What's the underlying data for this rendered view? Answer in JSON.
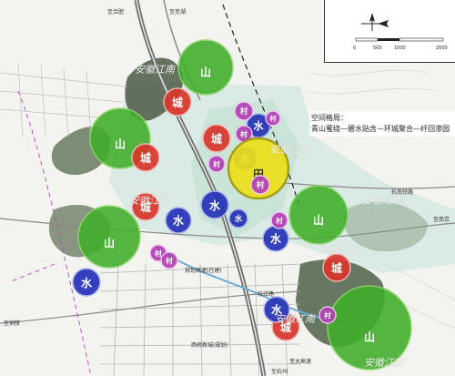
{
  "title": "空间格局：",
  "subtitle": "青山蜜绕—碧水贴含—环城聚合—纤回渗园",
  "road_labels": {
    "top_left": "至合肥",
    "top_mid": "至芜湖",
    "highway_right": "杭南铁路",
    "right_sub": "至南京",
    "mid": "杭江路",
    "left_plan": "规划高速(在建)",
    "bottom_left": "至铜陵",
    "bottom_road": "西桥新城(规划)",
    "bottom_mid": "至杭州",
    "bottom_end": "芜太高速"
  },
  "scale": {
    "ticks": [
      "0",
      "500",
      "1000",
      "2000"
    ]
  },
  "watermark": "安徽江南",
  "markers": [
    {
      "type": "mountain",
      "label": "山"
    },
    {
      "type": "mountain",
      "label": "山"
    },
    {
      "type": "mountain",
      "label": "山"
    },
    {
      "type": "mountain",
      "label": "山"
    },
    {
      "type": "mountain",
      "label": "山"
    },
    {
      "type": "city",
      "label": "城"
    },
    {
      "type": "city",
      "label": "城"
    },
    {
      "type": "city",
      "label": "城"
    },
    {
      "type": "city",
      "label": "城"
    },
    {
      "type": "city",
      "label": "城"
    },
    {
      "type": "city",
      "label": "城"
    },
    {
      "type": "water",
      "label": "水"
    },
    {
      "type": "water",
      "label": "水"
    },
    {
      "type": "water",
      "label": "水"
    },
    {
      "type": "water",
      "label": "水"
    },
    {
      "type": "water",
      "label": "水"
    },
    {
      "type": "water",
      "label": "水"
    },
    {
      "type": "water",
      "label": "水"
    },
    {
      "type": "water",
      "label": "水"
    },
    {
      "type": "village",
      "label": "村"
    },
    {
      "type": "village",
      "label": "村"
    },
    {
      "type": "village",
      "label": "村"
    },
    {
      "type": "village",
      "label": "村"
    },
    {
      "type": "village",
      "label": "村"
    },
    {
      "type": "village",
      "label": "村"
    },
    {
      "type": "village",
      "label": "村"
    },
    {
      "type": "village",
      "label": "村"
    },
    {
      "type": "field",
      "label": "田"
    },
    {
      "type": "village",
      "label": "村"
    }
  ],
  "colors": {
    "mountain": "#3fae2a",
    "city": "#d9362c",
    "water": "#2532b8",
    "village": "#b43fb6",
    "field": "#ede01a"
  }
}
